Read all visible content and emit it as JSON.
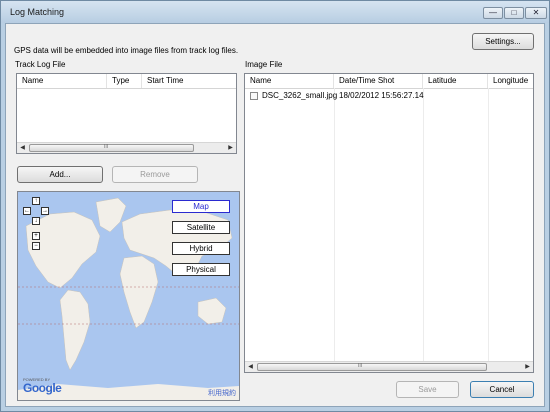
{
  "window": {
    "title": "Log Matching",
    "minimize": "—",
    "maximize": "□",
    "close": "✕"
  },
  "info_text": "GPS data will be embedded into image files from track log files.",
  "settings_button": "Settings...",
  "track_log": {
    "label": "Track Log File",
    "columns": [
      "Name",
      "Type",
      "Start Time"
    ],
    "rows": []
  },
  "add_button": "Add...",
  "remove_button": "Remove",
  "image_file": {
    "label": "Image File",
    "columns": [
      "Name",
      "Date/Time Shot",
      "Latitude",
      "Longitude"
    ],
    "rows": [
      {
        "checked": false,
        "name": "DSC_3262_small.jpg",
        "datetime": "18/02/2012 15:56:27.14",
        "latitude": "",
        "longitude": ""
      }
    ]
  },
  "map": {
    "types": [
      "Map",
      "Satellite",
      "Hybrid",
      "Physical"
    ],
    "selected_type": "Map",
    "nav": {
      "up": "↑",
      "left": "←",
      "right": "→",
      "down": "↓",
      "zoom_in": "+",
      "zoom_out": "−"
    },
    "powered_by": "POWERED BY",
    "logo": "Google",
    "terms_link": "利用規約",
    "colors": {
      "water": "#aac6ef",
      "land": "#f2efe9",
      "selected": "#2a2ad0"
    }
  },
  "scroll_glyphs": {
    "left": "◀",
    "right": "▶",
    "grip": "III"
  },
  "save_button": "Save",
  "cancel_button": "Cancel"
}
